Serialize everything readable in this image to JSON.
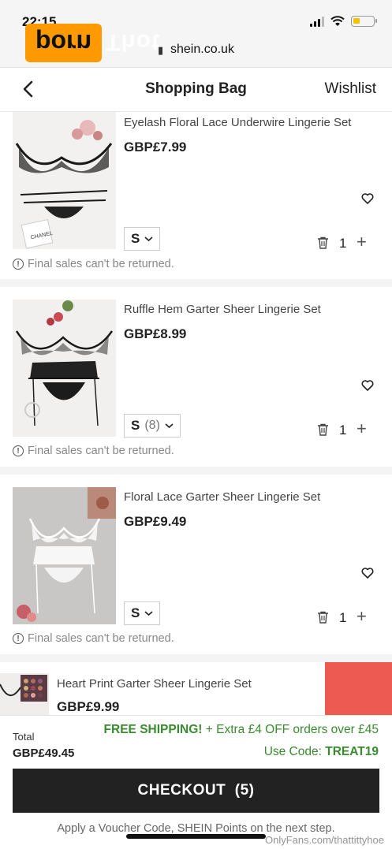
{
  "status_bar": {
    "time": "22:15"
  },
  "watermark": {
    "logo_text": "porn",
    "logo_suffix": "Thot"
  },
  "browser": {
    "url": "shein.co.uk"
  },
  "nav": {
    "title": "Shopping Bag",
    "wishlist": "Wishlist"
  },
  "items": [
    {
      "name": "Eyelash Floral Lace Underwire Lingerie Set",
      "price": "GBP£7.99",
      "size": "S",
      "stock": "",
      "qty": "1",
      "note": "Final sales can't be returned.",
      "image_label": "CHANEL"
    },
    {
      "name": "Ruffle Hem Garter Sheer Lingerie Set",
      "price": "GBP£8.99",
      "size": "S",
      "stock": "(8)",
      "qty": "1",
      "note": "Final sales can't be returned."
    },
    {
      "name": "Floral Lace Garter Sheer Lingerie Set",
      "price": "GBP£9.49",
      "size": "S",
      "stock": "",
      "qty": "1",
      "note": "Final sales can't be returned."
    }
  ],
  "peek_item": {
    "name": "Heart Print Garter Sheer Lingerie Set",
    "price": "GBP£9.99"
  },
  "footer": {
    "total_label": "Total",
    "total": "GBP£49.45",
    "promo_highlight": "FREE SHIPPING!",
    "promo_rest": " + Extra £4 OFF orders over £45",
    "code_label": "Use Code: ",
    "code_value": "TREAT19",
    "checkout": "CHECKOUT  (5)",
    "voucher": "Apply a Voucher Code, SHEIN Points on the next step."
  },
  "credit": "OnlyFans.com/thattittyhoe",
  "colors": {
    "promo_green": "#3a8a2f",
    "checkout_bg": "#222222",
    "red_accent": "#ec5a52",
    "watermark_orange": "#ff9900"
  }
}
